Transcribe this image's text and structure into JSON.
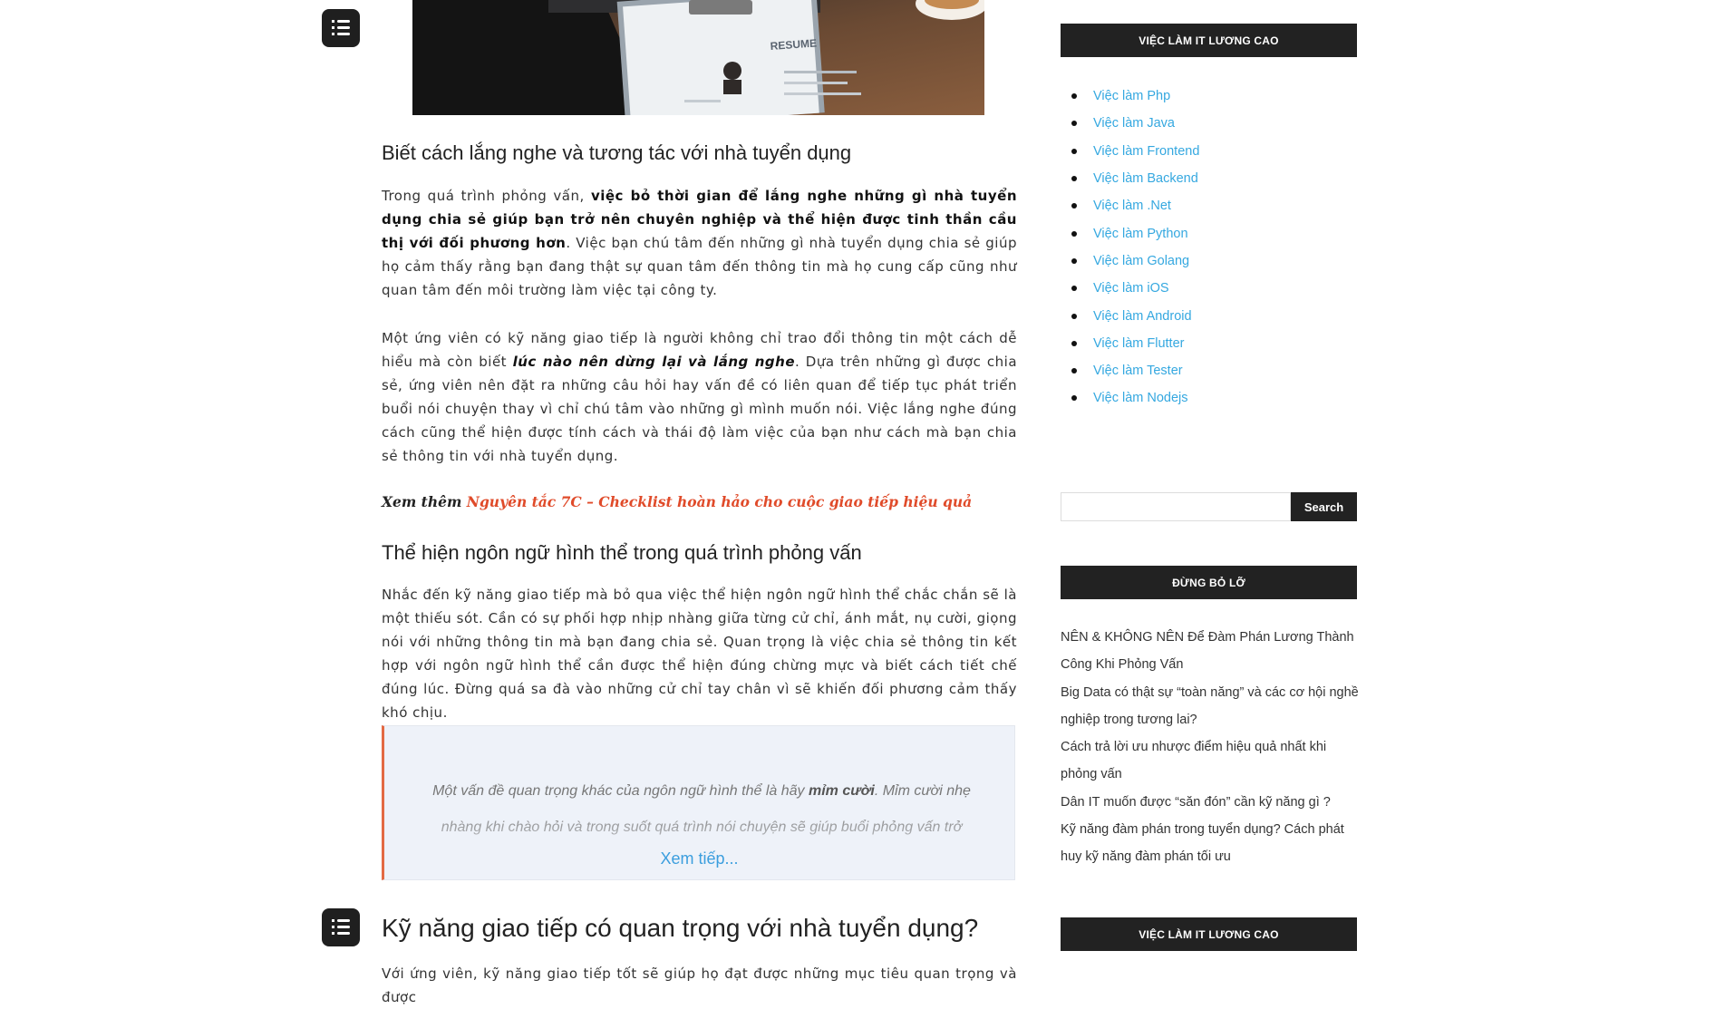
{
  "article": {
    "section1_title": "Biết cách lắng nghe và tương tác với nhà tuyển dụng",
    "p1_a": "Trong quá trình phỏng vấn, ",
    "p1_b": "việc bỏ thời gian để lắng nghe những gì nhà tuyển dụng chia sẻ giúp bạn trở nên chuyên nghiệp và thể hiện được tinh thần cầu thị với đối phương hơn",
    "p1_c": ". Việc bạn chú tâm đến những gì nhà tuyển dụng chia sẻ giúp họ cảm thấy rằng bạn đang thật sự quan tâm đến thông tin mà họ cung cấp cũng như quan tâm đến môi trường làm việc tại công ty.",
    "p2_a": "Một ứng viên có kỹ năng giao tiếp là người không chỉ trao đổi thông tin một cách dễ hiểu mà còn biết ",
    "p2_b": "lúc nào nên dừng lại và lắng nghe",
    "p2_c": ". Dựa trên những gì được chia sẻ, ứng viên nên đặt ra những câu hỏi hay vấn đề có liên quan để tiếp tục phát triển buổi nói chuyện thay vì chỉ chú tâm vào những gì mình muốn nói. Việc lắng nghe đúng cách cũng thể hiện được tính cách và thái độ làm việc của bạn như cách mà bạn chia sẻ thông tin với nhà tuyển dụng.",
    "see_also_label": "Xem thêm",
    "see_also_link": "Nguyên tắc 7C – Checklist hoàn hảo cho cuộc giao tiếp hiệu quả",
    "section2_title": "Thể hiện ngôn ngữ hình thể trong quá trình phỏng vấn",
    "p3": "Nhắc đến kỹ năng giao tiếp mà bỏ qua việc thể hiện ngôn ngữ hình thể chắc chắn sẽ là một thiếu sót. Cần có sự phối hợp nhịp nhàng giữa từng cử chỉ, ánh mắt, nụ cười, giọng nói với những thông tin mà bạn đang chia sẻ. Quan trọng là việc chia sẻ thông tin kết hợp với ngôn ngữ hình thể cần được thể hiện đúng chừng mực và biết cách tiết chế đúng lúc. Đừng quá sa đà vào những cử chỉ tay chân vì sẽ khiến đối phương cảm thấy khó chịu.",
    "quote_a": "Một vấn đề quan trọng khác của ngôn ngữ hình thể là hãy ",
    "quote_b": "mỉm cười",
    "quote_c": ". Mỉm cười nhẹ nhàng khi chào hỏi và trong suốt quá trình nói chuyện sẽ giúp buổi phỏng vấn trở",
    "read_more": "Xem tiếp...",
    "main_title": "Kỹ năng giao tiếp có quan trọng với nhà tuyển dụng?",
    "p4": "Với ứng viên, kỹ năng giao tiếp tốt sẽ giúp họ đạt được những mục tiêu quan trọng và được"
  },
  "hero": {
    "resume_label": "RESUME"
  },
  "sidebar": {
    "jobs_title": "VIỆC LÀM IT LƯƠNG CAO",
    "jobs": [
      "Việc làm Php",
      "Việc làm Java",
      "Việc làm Frontend",
      "Việc làm Backend",
      "Việc làm .Net",
      "Việc làm Python",
      "Việc làm Golang",
      "Việc làm iOS",
      "Việc làm Android",
      "Việc làm Flutter",
      "Việc làm Tester",
      "Việc làm Nodejs"
    ],
    "search_button": "Search",
    "search_value": "",
    "dont_miss_title": "ĐỪNG BỎ LỠ",
    "posts": [
      "NÊN & KHÔNG NÊN Để Đàm Phán Lương Thành Công Khi Phỏng Vấn",
      "Big Data có thật sự “toàn năng” và các cơ hội nghề nghiệp trong tương lai?",
      "Cách trả lời ưu nhược điểm hiệu quả nhất khi phỏng vấn",
      "Dân IT muốn được “săn đón” cần kỹ năng gì ?",
      "Kỹ năng đàm phán trong tuyển dụng? Cách phát huy kỹ năng đàm phán tối ưu"
    ],
    "jobs_title_2": "VIỆC LÀM IT LƯƠNG CAO"
  },
  "colors": {
    "link": "#35a8e0",
    "see_also": "#e04b2a",
    "quote_border": "#e36a44",
    "widget_bg": "#222222"
  },
  "icons": {
    "toc": "list-icon"
  }
}
